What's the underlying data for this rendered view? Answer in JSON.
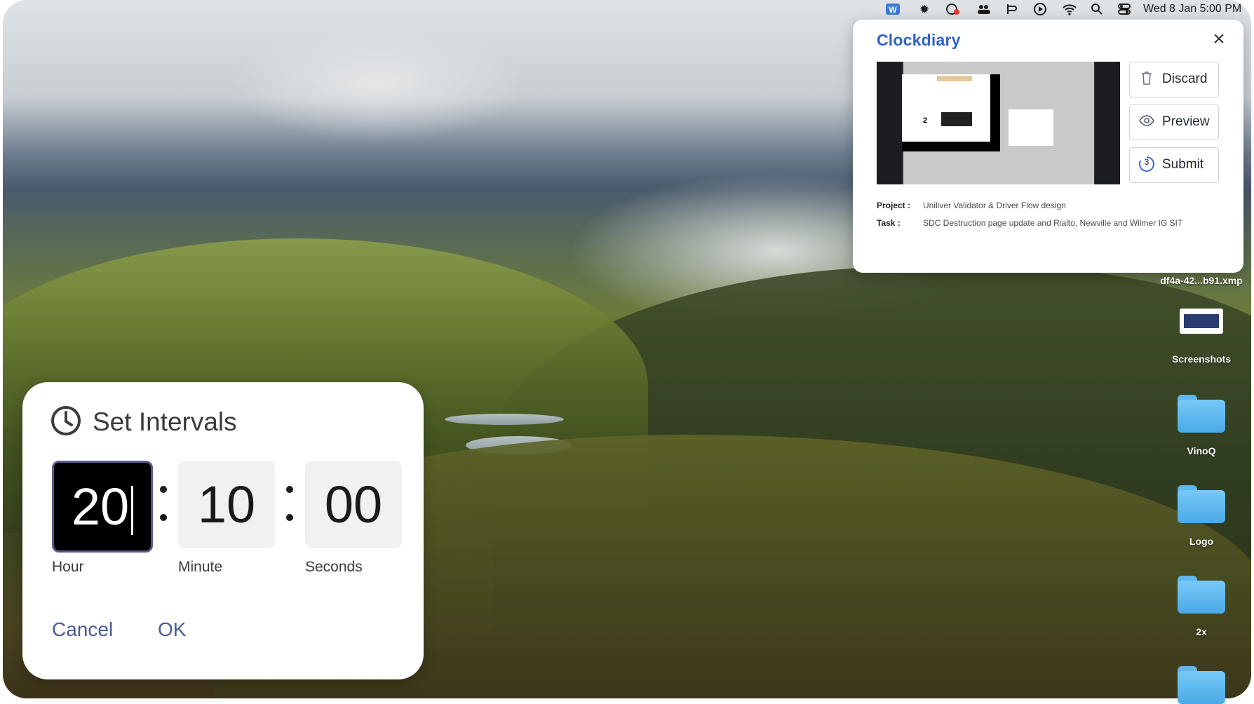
{
  "menubar": {
    "clock": "Wed 8 Jan  5:00 PM",
    "icons": [
      "clockdiary-app-icon",
      "gear-icon",
      "cloud-sync-icon",
      "users-icon",
      "ingress-icon",
      "play-icon",
      "wifi-icon",
      "search-icon",
      "control-center-icon"
    ]
  },
  "clockdiary": {
    "logo": "Clockdiary",
    "buttons": {
      "discard": "Discard",
      "preview": "Preview",
      "submit": "Submit"
    },
    "submit_countdown": "3",
    "project_label": "Project :",
    "project_value": "Uniliver Validator & Driver Flow design",
    "task_label": "Task :",
    "task_value": "SDC Destruction page update and Rialto, Newville and Wilmer IG SIT",
    "thumbnail": {
      "counter": "2"
    }
  },
  "desktop": {
    "items": [
      {
        "name": "df4a-42...b91.xmp"
      },
      {
        "name": "Screenshots"
      },
      {
        "name": "VinoQ"
      },
      {
        "name": "Logo"
      },
      {
        "name": "2x"
      }
    ]
  },
  "dialog": {
    "title": "Set Intervals",
    "hour": "20",
    "minute": "10",
    "seconds": "00",
    "hour_label": "Hour",
    "minute_label": "Minute",
    "seconds_label": "Seconds",
    "cancel": "Cancel",
    "ok": "OK"
  },
  "colors": {
    "accent": "#4a5a9a",
    "brand": "#2f62c9"
  }
}
